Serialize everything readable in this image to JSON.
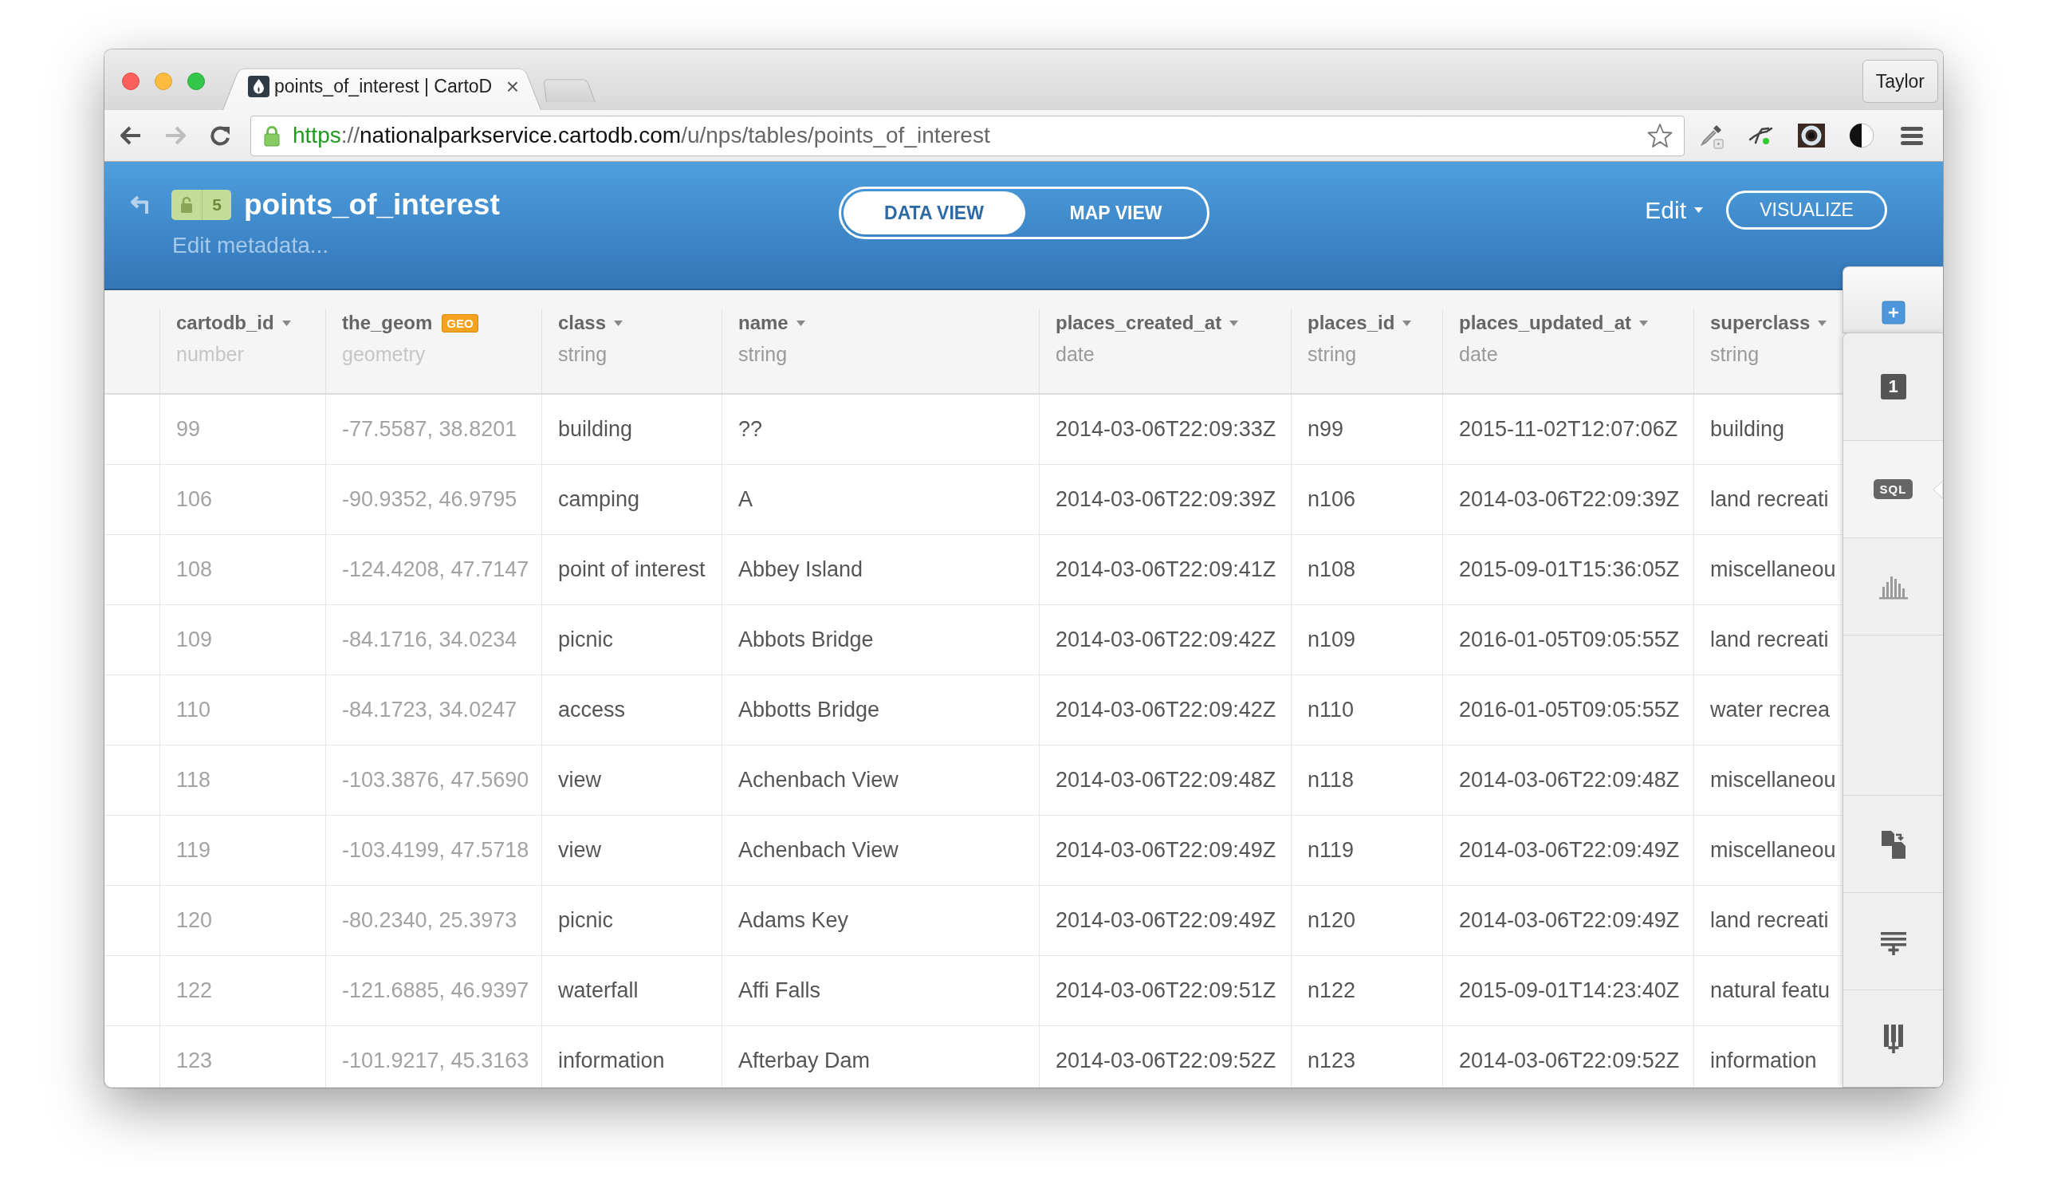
{
  "browser": {
    "tab": {
      "title": "points_of_interest | CartoD",
      "close": "×"
    },
    "profile_button": "Taylor",
    "address": {
      "scheme": "https",
      "separator": "://",
      "host": "nationalparkservice.cartodb.com",
      "path": "/u/nps/tables/points_of_interest"
    }
  },
  "header": {
    "privacy_count": "5",
    "title": "points_of_interest",
    "edit_metadata": "Edit metadata...",
    "view_toggle": [
      {
        "label": "DATA VIEW",
        "selected": true
      },
      {
        "label": "MAP VIEW",
        "selected": false
      }
    ],
    "edit_menu": "Edit",
    "visualize_button": "VISUALIZE"
  },
  "table": {
    "columns": [
      {
        "name": "cartodb_id",
        "type": "number",
        "kind": "id"
      },
      {
        "name": "the_geom",
        "type": "geometry",
        "kind": "geometry",
        "badge": "GEO"
      },
      {
        "name": "class",
        "type": "string",
        "kind": "field"
      },
      {
        "name": "name",
        "type": "string",
        "kind": "field"
      },
      {
        "name": "places_created_at",
        "type": "date",
        "kind": "field"
      },
      {
        "name": "places_id",
        "type": "string",
        "kind": "field"
      },
      {
        "name": "places_updated_at",
        "type": "date",
        "kind": "field"
      },
      {
        "name": "superclass",
        "type": "string",
        "kind": "field"
      }
    ],
    "rows": [
      {
        "cells": [
          "99",
          "-77.5587, 38.8201",
          "building",
          "??",
          "2014-03-06T22:09:33Z",
          "n99",
          "2015-11-02T12:07:06Z",
          "building"
        ]
      },
      {
        "cells": [
          "106",
          "-90.9352, 46.9795",
          "camping",
          "A",
          "2014-03-06T22:09:39Z",
          "n106",
          "2014-03-06T22:09:39Z",
          "land recreati"
        ]
      },
      {
        "cells": [
          "108",
          "-124.4208, 47.7147",
          "point of interest",
          "Abbey Island",
          "2014-03-06T22:09:41Z",
          "n108",
          "2015-09-01T15:36:05Z",
          "miscellaneou"
        ]
      },
      {
        "cells": [
          "109",
          "-84.1716, 34.0234",
          "picnic",
          "Abbots Bridge",
          "2014-03-06T22:09:42Z",
          "n109",
          "2016-01-05T09:05:55Z",
          "land recreati"
        ]
      },
      {
        "cells": [
          "110",
          "-84.1723, 34.0247",
          "access",
          "Abbotts Bridge",
          "2014-03-06T22:09:42Z",
          "n110",
          "2016-01-05T09:05:55Z",
          "water recrea"
        ]
      },
      {
        "cells": [
          "118",
          "-103.3876, 47.5690",
          "view",
          "Achenbach View",
          "2014-03-06T22:09:48Z",
          "n118",
          "2014-03-06T22:09:48Z",
          "miscellaneou"
        ]
      },
      {
        "cells": [
          "119",
          "-103.4199, 47.5718",
          "view",
          "Achenbach View",
          "2014-03-06T22:09:49Z",
          "n119",
          "2014-03-06T22:09:49Z",
          "miscellaneou"
        ]
      },
      {
        "cells": [
          "120",
          "-80.2340, 25.3973",
          "picnic",
          "Adams Key",
          "2014-03-06T22:09:49Z",
          "n120",
          "2014-03-06T22:09:49Z",
          "land recreati"
        ]
      },
      {
        "cells": [
          "122",
          "-121.6885, 46.9397",
          "waterfall",
          "Affi Falls",
          "2014-03-06T22:09:51Z",
          "n122",
          "2015-09-01T14:23:40Z",
          "natural featu"
        ]
      },
      {
        "cells": [
          "123",
          "-101.9217, 45.3163",
          "information",
          "Afterbay Dam",
          "2014-03-06T22:09:52Z",
          "n123",
          "2014-03-06T22:09:52Z",
          "information"
        ]
      }
    ]
  },
  "sidebar": {
    "tools": [
      {
        "kind": "count",
        "label": "1",
        "selected": false
      },
      {
        "kind": "sql",
        "label": "SQL",
        "selected": true
      },
      {
        "kind": "chart",
        "selected": false
      }
    ],
    "actions": [
      {
        "kind": "merge"
      },
      {
        "kind": "add-row"
      },
      {
        "kind": "add-column"
      }
    ]
  }
}
